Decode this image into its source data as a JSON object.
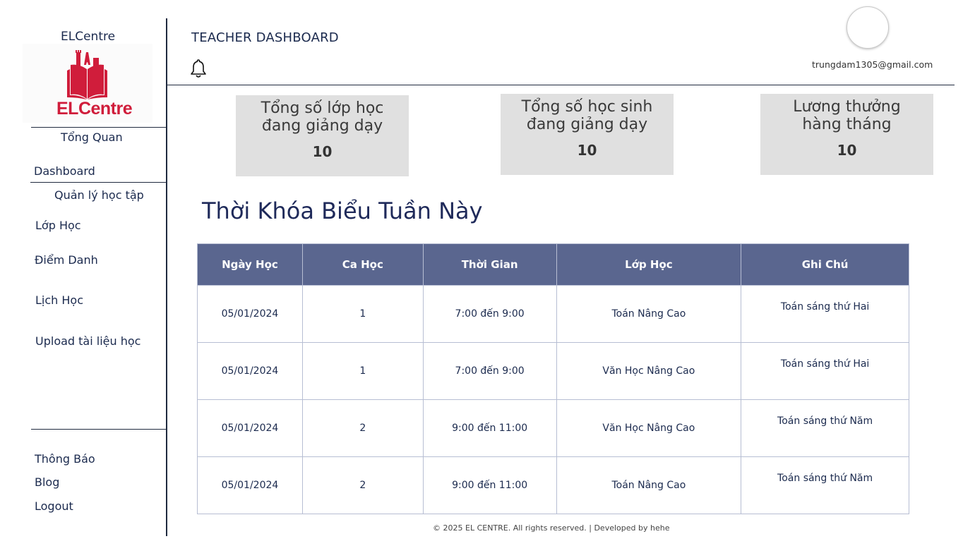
{
  "sidebar": {
    "brand_title": "ELCentre",
    "logo_text": "ELCentre",
    "overview_label": "Tổng Quan",
    "dashboard_label": "Dashboard",
    "learning_group_label": "Quản lý học tập",
    "items": [
      {
        "label": "Lớp Học"
      },
      {
        "label": "Điểm Danh"
      },
      {
        "label": "Lịch Học"
      },
      {
        "label": "Upload tài liệu học"
      }
    ],
    "bottom_items": [
      {
        "label": "Thông Báo"
      },
      {
        "label": "Blog"
      },
      {
        "label": "Logout"
      }
    ]
  },
  "header": {
    "title": "TEACHER DASHBOARD",
    "email": "trungdam1305@gmail.com"
  },
  "stats": [
    {
      "label": "Tổng số lớp học đang giảng dạy",
      "value": "10"
    },
    {
      "label": "Tổng số học sinh đang giảng dạy",
      "value": "10"
    },
    {
      "label": "Lương thưởng hàng tháng",
      "value": "10"
    }
  ],
  "schedule": {
    "title": "Thời Khóa Biểu Tuần Này",
    "columns": [
      "Ngày Học",
      "Ca Học",
      "Thời Gian",
      "Lớp Học",
      "Ghi Chú"
    ],
    "rows": [
      [
        "05/01/2024",
        "1",
        "7:00 đến 9:00",
        "Toán Nâng Cao",
        "Toán sáng thứ Hai"
      ],
      [
        "05/01/2024",
        "1",
        "7:00 đến 9:00",
        "Văn Học Nâng Cao",
        "Toán sáng thứ Hai"
      ],
      [
        "05/01/2024",
        "2",
        "9:00 đến 11:00",
        "Văn Học Nâng Cao",
        "Toán sáng thứ Năm"
      ],
      [
        "05/01/2024",
        "2",
        "9:00 đến 11:00",
        "Toán Nâng Cao",
        "Toán sáng thứ Năm"
      ]
    ]
  },
  "footer": {
    "text": "© 2025 EL CENTRE. All rights reserved. | Developed by hehe"
  },
  "icons": {
    "notification": "bell-icon",
    "logo": "book-castle-logo"
  },
  "colors": {
    "brand_red": "#d01d3b",
    "table_header": "#5a668f",
    "card_bg": "#e0e0e0",
    "text_navy": "#1b2a4e"
  }
}
